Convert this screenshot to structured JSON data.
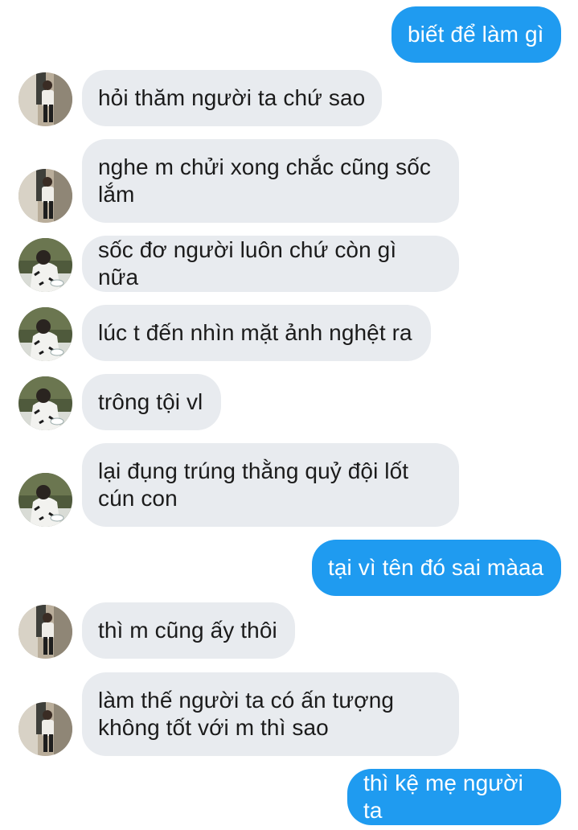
{
  "messages": [
    {
      "side": "out",
      "text": "biết để làm gì"
    },
    {
      "side": "in",
      "avatar": "person-standing-avatar-icon",
      "text": "hỏi thăm người ta chứ sao"
    },
    {
      "side": "in",
      "avatar": "person-standing-avatar-icon",
      "text": "nghe m chửi xong chắc cũng sốc\nlắm"
    },
    {
      "side": "in",
      "avatar": "person-seated-avatar-icon",
      "text": "sốc đơ người luôn chứ còn gì nữa"
    },
    {
      "side": "in",
      "avatar": "person-seated-avatar-icon",
      "text": "lúc t đến nhìn mặt ảnh nghệt ra"
    },
    {
      "side": "in",
      "avatar": "person-seated-avatar-icon",
      "text": "trông tội vl"
    },
    {
      "side": "in",
      "avatar": "person-seated-avatar-icon",
      "text": "lại đụng trúng thằng quỷ đội lốt\ncún con"
    },
    {
      "side": "out",
      "text": "tại vì tên đó sai màaa"
    },
    {
      "side": "in",
      "avatar": "person-standing-avatar-icon",
      "text": "thì m cũng ấy thôi"
    },
    {
      "side": "in",
      "avatar": "person-standing-avatar-icon",
      "text": "làm thế người ta có ấn tượng\nkhông tốt với m thì sao"
    },
    {
      "side": "out",
      "text": "thì kệ mẹ người ta"
    }
  ],
  "colors": {
    "outgoing_bubble": "#1f9bf0",
    "incoming_bubble": "#e8ebef",
    "incoming_text": "#1b1b1b",
    "outgoing_text": "#ffffff"
  }
}
